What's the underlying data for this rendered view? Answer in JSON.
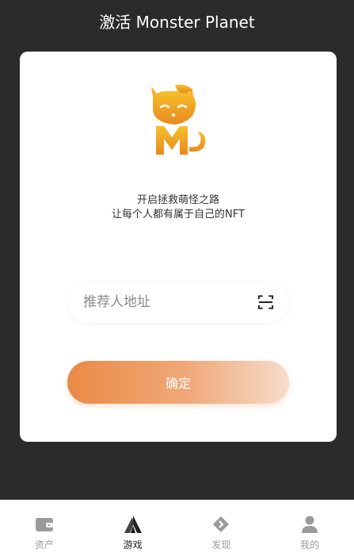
{
  "header": {
    "title": "激活 Monster Planet"
  },
  "card": {
    "slogan_line1": "开启拯救萌怪之路",
    "slogan_line2": "让每个人都有属于自己的NFT",
    "referrer_field": {
      "placeholder": "推荐人地址",
      "value": ""
    },
    "confirm_label": "确定"
  },
  "tabbar": {
    "items": [
      {
        "label": "资产",
        "icon": "wallet-icon",
        "active": false
      },
      {
        "label": "游戏",
        "icon": "game-icon",
        "active": true
      },
      {
        "label": "发现",
        "icon": "discover-icon",
        "active": false
      },
      {
        "label": "我的",
        "icon": "profile-icon",
        "active": false
      }
    ]
  },
  "colors": {
    "background": "#2b2b2b",
    "accent_start": "#ea8a45",
    "accent_end": "#f6dccb",
    "logo_gold": "#f2b01e"
  }
}
